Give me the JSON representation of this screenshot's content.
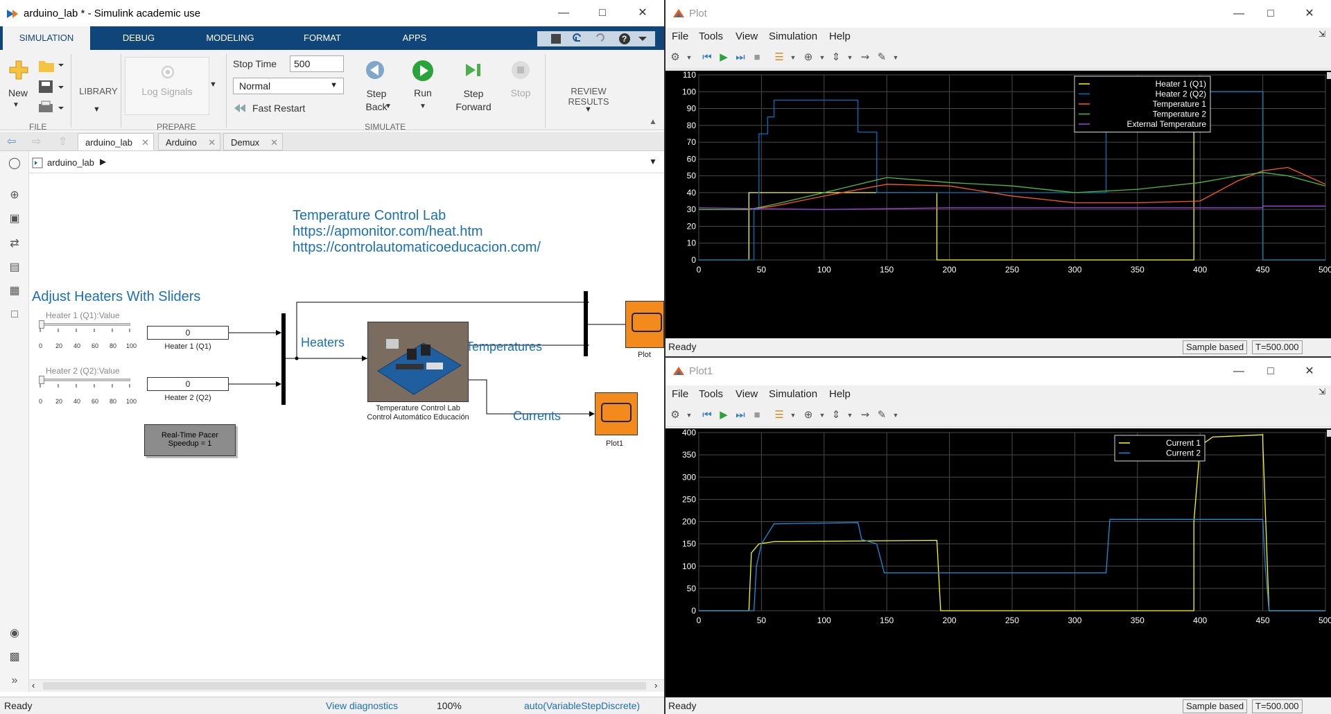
{
  "simulink": {
    "title": "arduino_lab * - Simulink academic use",
    "ribbon_tabs": [
      "SIMULATION",
      "DEBUG",
      "MODELING",
      "FORMAT",
      "APPS"
    ],
    "file": {
      "new": "New",
      "section": "FILE"
    },
    "library": {
      "label": "LIBRARY"
    },
    "prepare": {
      "log_signals": "Log Signals",
      "section": "PREPARE"
    },
    "simulate": {
      "stop_time_label": "Stop Time",
      "stop_time_value": "500",
      "mode": "Normal",
      "fast_restart": "Fast Restart",
      "step_back": "Step Back",
      "run": "Run",
      "step_forward": "Step Forward",
      "stop": "Stop",
      "section": "SIMULATE"
    },
    "review": {
      "label": "REVIEW RESULTS"
    },
    "doc_tabs": [
      "arduino_lab",
      "Arduino",
      "Demux"
    ],
    "address": "arduino_lab",
    "canvas": {
      "annotation_title": "Temperature Control Lab",
      "annotation_url1": "https://apmonitor.com/heat.htm",
      "annotation_url2": "https://controlautomaticoeducacion.com/",
      "sliders_title": "Adjust Heaters With Sliders",
      "slider1_label": "Heater 1 (Q1):Value",
      "slider2_label": "Heater 2 (Q2):Value",
      "slider_ticks": [
        "0",
        "20",
        "40",
        "60",
        "80",
        "100"
      ],
      "slider1_value": 0,
      "slider2_value": 0,
      "display1_value": "0",
      "display1_label": "Heater 1 (Q1)",
      "display2_value": "0",
      "display2_label": "Heater 2 (Q2)",
      "pacer_line1": "Real-Time Pacer",
      "pacer_line2": "Speedup = 1",
      "heaters_label": "Heaters",
      "temperatures_label": "Temperatures",
      "currents_label": "Currents",
      "arduino_label1": "Temperature Control Lab",
      "arduino_label2": "Control Automático Educación",
      "scope1_label": "Plot",
      "scope2_label": "Plot1"
    },
    "status": {
      "ready": "Ready",
      "diagnostics": "View diagnostics",
      "zoom": "100%",
      "solver": "auto(VariableStepDiscrete)"
    }
  },
  "plot1": {
    "title": "Plot",
    "menu": [
      "File",
      "Tools",
      "View",
      "Simulation",
      "Help"
    ],
    "status_ready": "Ready",
    "sample_based": "Sample based",
    "time": "T=500.000",
    "y_ticks": [
      "0",
      "10",
      "20",
      "30",
      "40",
      "50",
      "60",
      "70",
      "80",
      "90",
      "100",
      "110"
    ],
    "x_ticks": [
      "0",
      "50",
      "100",
      "150",
      "200",
      "250",
      "300",
      "350",
      "400",
      "450",
      "500"
    ],
    "legend": [
      "Heater 1 (Q1)",
      "Heater 2 (Q2)",
      "Temperature 1",
      "Temperature 2",
      "External Temperature"
    ],
    "colors": [
      "#ffff00",
      "#0072bd",
      "#ff5a1f",
      "#4dbe3c",
      "#a040e0"
    ]
  },
  "plot2": {
    "title": "Plot1",
    "menu": [
      "File",
      "Tools",
      "View",
      "Simulation",
      "Help"
    ],
    "status_ready": "Ready",
    "sample_based": "Sample based",
    "time": "T=500.000",
    "y_ticks": [
      "0",
      "50",
      "100",
      "150",
      "200",
      "250",
      "300",
      "350",
      "400"
    ],
    "x_ticks": [
      "0",
      "50",
      "100",
      "150",
      "200",
      "250",
      "300",
      "350",
      "400",
      "450",
      "500"
    ],
    "legend": [
      "Current 1",
      "Current 2"
    ],
    "colors": [
      "#ffff00",
      "#1a8fe0"
    ]
  },
  "chart_data": [
    {
      "type": "line",
      "xlim": [
        0,
        500
      ],
      "ylim": [
        0,
        110
      ],
      "grid": true,
      "legend_position": "top-right",
      "series": [
        {
          "name": "Heater 1 (Q1)",
          "x": [
            0,
            40,
            40,
            190,
            190,
            395,
            395,
            450,
            450,
            500
          ],
          "y": [
            0,
            0,
            40,
            40,
            0,
            0,
            100,
            100,
            0,
            0
          ]
        },
        {
          "name": "Heater 2 (Q2)",
          "x": [
            0,
            44,
            44,
            48,
            48,
            55,
            55,
            60,
            60,
            64,
            64,
            127,
            127,
            142,
            142,
            325,
            325,
            450,
            450,
            500
          ],
          "y": [
            0,
            0,
            30,
            30,
            75,
            75,
            85,
            85,
            95,
            95,
            95,
            95,
            76,
            76,
            40,
            40,
            100,
            100,
            0,
            0
          ]
        },
        {
          "name": "Temperature 1",
          "x": [
            0,
            40,
            60,
            100,
            150,
            200,
            250,
            300,
            350,
            400,
            430,
            450,
            470,
            500
          ],
          "y": [
            30,
            30,
            32,
            38,
            45,
            44,
            38,
            34,
            34,
            35,
            47,
            53,
            55,
            45
          ]
        },
        {
          "name": "Temperature 2",
          "x": [
            0,
            40,
            60,
            100,
            150,
            200,
            250,
            300,
            350,
            400,
            430,
            450,
            470,
            500
          ],
          "y": [
            30,
            30,
            33,
            40,
            49,
            46,
            44,
            40,
            42,
            46,
            50,
            52,
            50,
            44
          ]
        },
        {
          "name": "External Temperature",
          "x": [
            0,
            100,
            200,
            300,
            400,
            450,
            450,
            500
          ],
          "y": [
            31,
            30,
            31,
            31,
            31,
            31,
            32,
            32
          ]
        }
      ]
    },
    {
      "type": "line",
      "xlim": [
        0,
        500
      ],
      "ylim": [
        0,
        400
      ],
      "grid": true,
      "legend_position": "top-right",
      "series": [
        {
          "name": "Current 1",
          "x": [
            0,
            40,
            42,
            48,
            60,
            190,
            190,
            193,
            395,
            395,
            400,
            410,
            450,
            450,
            455,
            500
          ],
          "y": [
            0,
            0,
            130,
            150,
            155,
            158,
            158,
            0,
            0,
            200,
            370,
            390,
            395,
            380,
            0,
            0
          ]
        },
        {
          "name": "Current 2",
          "x": [
            0,
            44,
            46,
            50,
            60,
            127,
            130,
            142,
            148,
            325,
            328,
            450,
            452,
            455,
            500
          ],
          "y": [
            0,
            0,
            100,
            150,
            195,
            198,
            160,
            150,
            85,
            85,
            205,
            205,
            100,
            0,
            0
          ]
        }
      ]
    }
  ]
}
